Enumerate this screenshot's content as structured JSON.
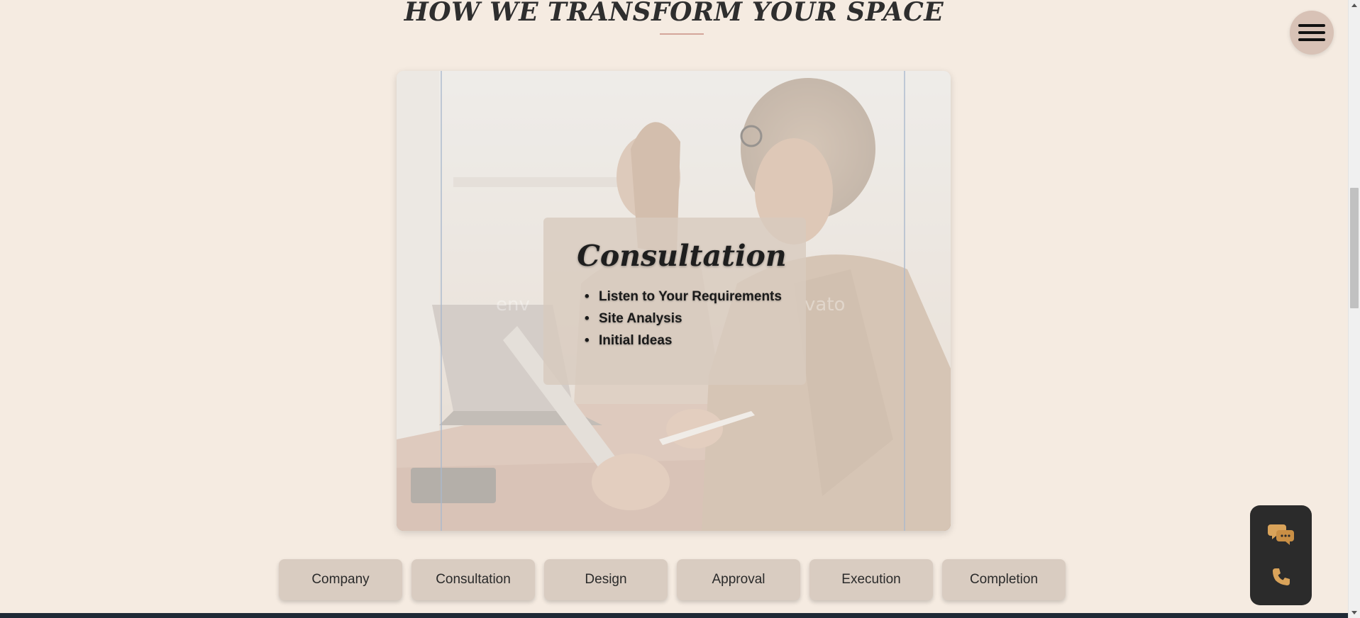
{
  "section": {
    "title": "HOW WE TRANSFORM YOUR SPACE",
    "divider_color": "#d4a59a"
  },
  "menu": {
    "icon": "hamburger-menu-icon"
  },
  "card": {
    "title": "Consultation",
    "points": [
      "Listen to Your Requirements",
      "Site Analysis",
      "Initial Ideas"
    ],
    "watermark_left": "env",
    "watermark_right": "vato"
  },
  "tabs": [
    {
      "label": "Company"
    },
    {
      "label": "Consultation"
    },
    {
      "label": "Design"
    },
    {
      "label": "Approval"
    },
    {
      "label": "Execution"
    },
    {
      "label": "Completion"
    }
  ],
  "contact_widget": {
    "chat_icon": "chat-bubbles-icon",
    "phone_icon": "phone-icon",
    "icon_color": "#d9a35a",
    "background": "#2b2b2b"
  },
  "colors": {
    "page_background": "#f5ebe1",
    "tab_background": "#d9ccc1",
    "menu_background": "#d8c2b6"
  }
}
